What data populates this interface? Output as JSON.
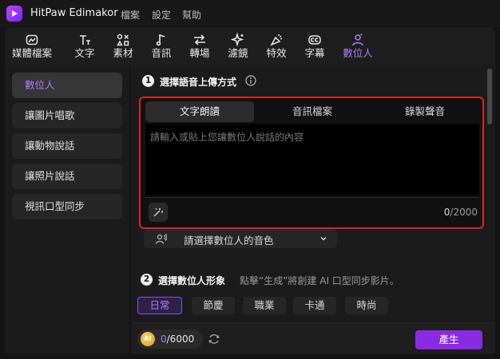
{
  "app": {
    "title": "HitPaw Edimakor",
    "accent": "#b27aff",
    "highlight_border": "#e02222",
    "button_color": "#8a2be2"
  },
  "menubar": [
    {
      "label": "檔案"
    },
    {
      "label": "設定"
    },
    {
      "label": "幫助"
    }
  ],
  "toolbar": [
    {
      "label": "媒體檔案",
      "icon": "media-icon",
      "active": false
    },
    {
      "label": "文字",
      "icon": "text-icon",
      "active": false
    },
    {
      "label": "素材",
      "icon": "assets-icon",
      "active": false
    },
    {
      "label": "音訊",
      "icon": "music-note-icon",
      "active": false
    },
    {
      "label": "轉場",
      "icon": "transition-icon",
      "active": false
    },
    {
      "label": "濾鏡",
      "icon": "sparkle-icon",
      "active": false
    },
    {
      "label": "特效",
      "icon": "effects-icon",
      "active": false
    },
    {
      "label": "字幕",
      "icon": "caption-icon",
      "active": false
    },
    {
      "label": "數位人",
      "icon": "digital-human-icon",
      "active": true
    }
  ],
  "sidebar": {
    "items": [
      {
        "label": "數位人",
        "active": true
      },
      {
        "label": "讓圖片唱歌",
        "active": false
      },
      {
        "label": "讓動物說話",
        "active": false
      },
      {
        "label": "讓照片說話",
        "active": false
      },
      {
        "label": "視訊口型同步",
        "active": false
      }
    ]
  },
  "step1": {
    "number": "1",
    "title": "選擇語音上傳方式",
    "tabs": [
      {
        "label": "文字朗讀",
        "active": true
      },
      {
        "label": "音訊檔案",
        "active": false
      },
      {
        "label": "錄製聲音",
        "active": false
      }
    ],
    "textarea": {
      "value": "",
      "placeholder": "請輸入或貼上您讓數位人說話的內容"
    },
    "counter": {
      "current": "0",
      "max": "/2000"
    },
    "voice_select": {
      "label": "請選擇數位人的音色"
    }
  },
  "step2": {
    "number": "2",
    "title": "選擇數位人形象",
    "hint": "點擊“生成”將創建 AI 口型同步影片。",
    "categories": [
      {
        "label": "日常",
        "active": true
      },
      {
        "label": "節慶",
        "active": false
      },
      {
        "label": "職業",
        "active": false
      },
      {
        "label": "卡通",
        "active": false
      },
      {
        "label": "時尚",
        "active": false
      }
    ]
  },
  "footer": {
    "credits": {
      "coin_label": "AI",
      "current": "0",
      "max": "/6000"
    },
    "generate_label": "產生"
  }
}
